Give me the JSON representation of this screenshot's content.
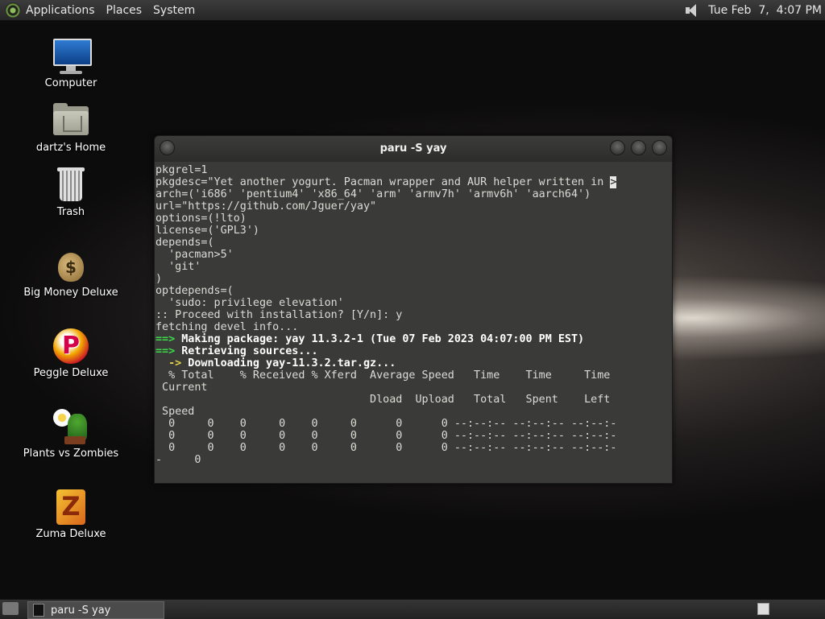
{
  "top_panel": {
    "menus": [
      "Applications",
      "Places",
      "System"
    ],
    "clock": "Tue Feb  7,  4:07 PM",
    "icons": [
      "gnome-foot-icon",
      "speaker-icon"
    ]
  },
  "desktop": {
    "icons": [
      {
        "label": "Computer",
        "icon": "computer-icon"
      },
      {
        "label": "dartz's Home",
        "icon": "home-folder-icon"
      },
      {
        "label": "Trash",
        "icon": "trash-icon"
      },
      {
        "label": "Big Money Deluxe",
        "icon": "money-bag-icon"
      },
      {
        "label": "Peggle Deluxe",
        "icon": "peggle-icon"
      },
      {
        "label": "Plants vs Zombies",
        "icon": "plants-vs-zombies-icon"
      },
      {
        "label": "Zuma Deluxe",
        "icon": "zuma-icon"
      }
    ]
  },
  "terminal": {
    "title": "paru -S yay",
    "lines": [
      "pkgrel=1",
      "pkgdesc=\"Yet another yogurt. Pacman wrapper and AUR helper written in ",
      "arch=('i686' 'pentium4' 'x86_64' 'arm' 'armv7h' 'armv6h' 'aarch64')",
      "url=\"https://github.com/Jguer/yay\"",
      "options=(!lto)",
      "license=('GPL3')",
      "depends=(",
      "  'pacman>5'",
      "  'git'",
      ")",
      "optdepends=(",
      "  'sudo: privilege elevation'",
      ":: Proceed with installation? [Y/n]: y",
      "fetching devel info..."
    ],
    "overflow_mark": ">",
    "status_lines": [
      {
        "marker": "==>",
        "text": " Making package: yay 11.3.2-1 (Tue 07 Feb 2023 04:07:00 PM EST)"
      },
      {
        "marker": "==>",
        "text": " Retrieving sources..."
      }
    ],
    "download_line": {
      "marker": "  ->",
      "text": " Downloading yay-11.3.2.tar.gz..."
    },
    "curl_lines": [
      "  % Total    % Received % Xferd  Average Speed   Time    Time     Time",
      " Current",
      "                                 Dload  Upload   Total   Spent    Left",
      " Speed",
      "  0     0    0     0    0     0      0      0 --:--:-- --:--:-- --:--:-",
      "  0     0    0     0    0     0      0      0 --:--:-- --:--:-- --:--:-",
      "  0     0    0     0    0     0      0      0 --:--:-- --:--:-- --:--:-",
      "-     0"
    ],
    "colors": {
      "green": "#3ed94a",
      "yellow": "#e6d246",
      "text": "#dcdcd6",
      "background": "#3a3a38"
    }
  },
  "bottom_panel": {
    "task_label": "paru -S yay"
  }
}
